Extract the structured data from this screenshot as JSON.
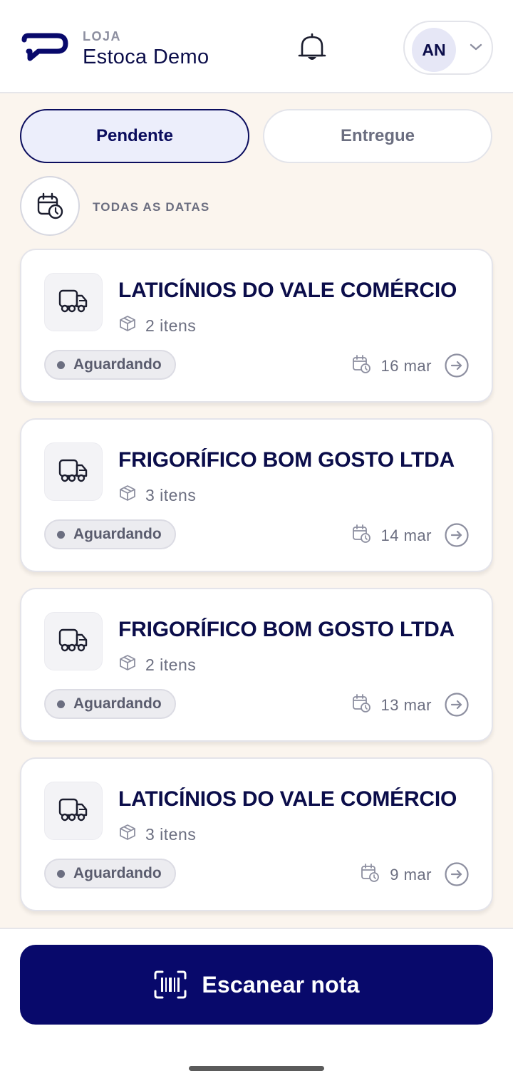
{
  "header": {
    "store_label": "LOJA",
    "store_name": "Estoca Demo",
    "user_initials": "AN"
  },
  "tabs": [
    {
      "label": "Pendente",
      "active": true
    },
    {
      "label": "Entregue",
      "active": false
    }
  ],
  "date_filter": {
    "label": "TODAS AS DATAS"
  },
  "deliveries": [
    {
      "supplier": "LATICÍNIOS DO VALE COMÉRCIO",
      "items": "2 itens",
      "status": "Aguardando",
      "date": "16 mar"
    },
    {
      "supplier": "FRIGORÍFICO BOM GOSTO LTDA",
      "items": "3 itens",
      "status": "Aguardando",
      "date": "14 mar"
    },
    {
      "supplier": "FRIGORÍFICO BOM GOSTO LTDA",
      "items": "2 itens",
      "status": "Aguardando",
      "date": "13 mar"
    },
    {
      "supplier": "LATICÍNIOS DO VALE COMÉRCIO",
      "items": "3 itens",
      "status": "Aguardando",
      "date": "9 mar"
    }
  ],
  "footer": {
    "scan_label": "Escanear nota"
  },
  "icons": {
    "logo": "brand-logo",
    "bell": "bell-icon",
    "chevron": "chevron-down-icon",
    "calendar": "calendar-clock-icon",
    "truck": "truck-icon",
    "box": "box-icon",
    "arrow": "arrow-right-circle-icon",
    "barcode": "barcode-scan-icon"
  },
  "colors": {
    "primary": "#08096b",
    "text": "#0b0d4a",
    "muted": "#6b6e80",
    "background": "#fbf5ee",
    "tab_active_bg": "#eceefb"
  }
}
